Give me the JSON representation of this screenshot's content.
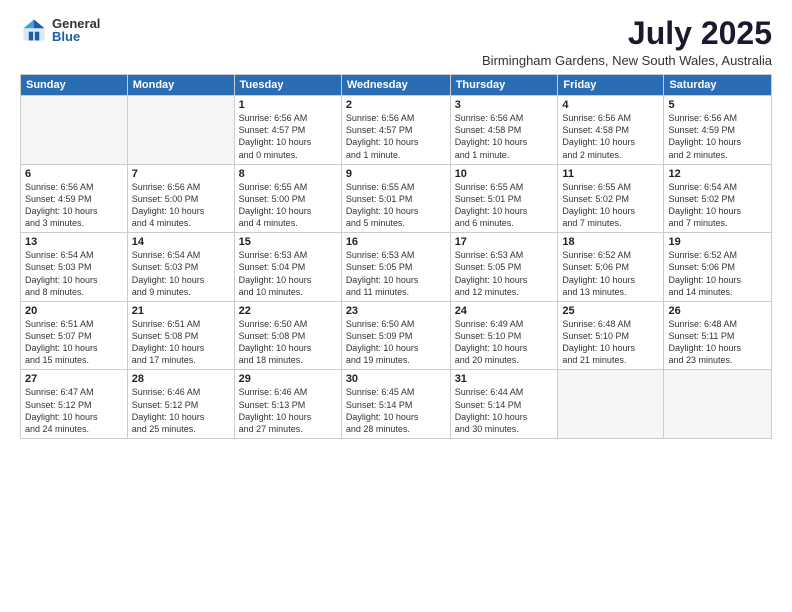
{
  "logo": {
    "general": "General",
    "blue": "Blue"
  },
  "header": {
    "month_year": "July 2025",
    "location": "Birmingham Gardens, New South Wales, Australia"
  },
  "days_of_week": [
    "Sunday",
    "Monday",
    "Tuesday",
    "Wednesday",
    "Thursday",
    "Friday",
    "Saturday"
  ],
  "weeks": [
    [
      {
        "day": "",
        "info": ""
      },
      {
        "day": "",
        "info": ""
      },
      {
        "day": "1",
        "info": "Sunrise: 6:56 AM\nSunset: 4:57 PM\nDaylight: 10 hours\nand 0 minutes."
      },
      {
        "day": "2",
        "info": "Sunrise: 6:56 AM\nSunset: 4:57 PM\nDaylight: 10 hours\nand 1 minute."
      },
      {
        "day": "3",
        "info": "Sunrise: 6:56 AM\nSunset: 4:58 PM\nDaylight: 10 hours\nand 1 minute."
      },
      {
        "day": "4",
        "info": "Sunrise: 6:56 AM\nSunset: 4:58 PM\nDaylight: 10 hours\nand 2 minutes."
      },
      {
        "day": "5",
        "info": "Sunrise: 6:56 AM\nSunset: 4:59 PM\nDaylight: 10 hours\nand 2 minutes."
      }
    ],
    [
      {
        "day": "6",
        "info": "Sunrise: 6:56 AM\nSunset: 4:59 PM\nDaylight: 10 hours\nand 3 minutes."
      },
      {
        "day": "7",
        "info": "Sunrise: 6:56 AM\nSunset: 5:00 PM\nDaylight: 10 hours\nand 4 minutes."
      },
      {
        "day": "8",
        "info": "Sunrise: 6:55 AM\nSunset: 5:00 PM\nDaylight: 10 hours\nand 4 minutes."
      },
      {
        "day": "9",
        "info": "Sunrise: 6:55 AM\nSunset: 5:01 PM\nDaylight: 10 hours\nand 5 minutes."
      },
      {
        "day": "10",
        "info": "Sunrise: 6:55 AM\nSunset: 5:01 PM\nDaylight: 10 hours\nand 6 minutes."
      },
      {
        "day": "11",
        "info": "Sunrise: 6:55 AM\nSunset: 5:02 PM\nDaylight: 10 hours\nand 7 minutes."
      },
      {
        "day": "12",
        "info": "Sunrise: 6:54 AM\nSunset: 5:02 PM\nDaylight: 10 hours\nand 7 minutes."
      }
    ],
    [
      {
        "day": "13",
        "info": "Sunrise: 6:54 AM\nSunset: 5:03 PM\nDaylight: 10 hours\nand 8 minutes."
      },
      {
        "day": "14",
        "info": "Sunrise: 6:54 AM\nSunset: 5:03 PM\nDaylight: 10 hours\nand 9 minutes."
      },
      {
        "day": "15",
        "info": "Sunrise: 6:53 AM\nSunset: 5:04 PM\nDaylight: 10 hours\nand 10 minutes."
      },
      {
        "day": "16",
        "info": "Sunrise: 6:53 AM\nSunset: 5:05 PM\nDaylight: 10 hours\nand 11 minutes."
      },
      {
        "day": "17",
        "info": "Sunrise: 6:53 AM\nSunset: 5:05 PM\nDaylight: 10 hours\nand 12 minutes."
      },
      {
        "day": "18",
        "info": "Sunrise: 6:52 AM\nSunset: 5:06 PM\nDaylight: 10 hours\nand 13 minutes."
      },
      {
        "day": "19",
        "info": "Sunrise: 6:52 AM\nSunset: 5:06 PM\nDaylight: 10 hours\nand 14 minutes."
      }
    ],
    [
      {
        "day": "20",
        "info": "Sunrise: 6:51 AM\nSunset: 5:07 PM\nDaylight: 10 hours\nand 15 minutes."
      },
      {
        "day": "21",
        "info": "Sunrise: 6:51 AM\nSunset: 5:08 PM\nDaylight: 10 hours\nand 17 minutes."
      },
      {
        "day": "22",
        "info": "Sunrise: 6:50 AM\nSunset: 5:08 PM\nDaylight: 10 hours\nand 18 minutes."
      },
      {
        "day": "23",
        "info": "Sunrise: 6:50 AM\nSunset: 5:09 PM\nDaylight: 10 hours\nand 19 minutes."
      },
      {
        "day": "24",
        "info": "Sunrise: 6:49 AM\nSunset: 5:10 PM\nDaylight: 10 hours\nand 20 minutes."
      },
      {
        "day": "25",
        "info": "Sunrise: 6:48 AM\nSunset: 5:10 PM\nDaylight: 10 hours\nand 21 minutes."
      },
      {
        "day": "26",
        "info": "Sunrise: 6:48 AM\nSunset: 5:11 PM\nDaylight: 10 hours\nand 23 minutes."
      }
    ],
    [
      {
        "day": "27",
        "info": "Sunrise: 6:47 AM\nSunset: 5:12 PM\nDaylight: 10 hours\nand 24 minutes."
      },
      {
        "day": "28",
        "info": "Sunrise: 6:46 AM\nSunset: 5:12 PM\nDaylight: 10 hours\nand 25 minutes."
      },
      {
        "day": "29",
        "info": "Sunrise: 6:46 AM\nSunset: 5:13 PM\nDaylight: 10 hours\nand 27 minutes."
      },
      {
        "day": "30",
        "info": "Sunrise: 6:45 AM\nSunset: 5:14 PM\nDaylight: 10 hours\nand 28 minutes."
      },
      {
        "day": "31",
        "info": "Sunrise: 6:44 AM\nSunset: 5:14 PM\nDaylight: 10 hours\nand 30 minutes."
      },
      {
        "day": "",
        "info": ""
      },
      {
        "day": "",
        "info": ""
      }
    ]
  ]
}
